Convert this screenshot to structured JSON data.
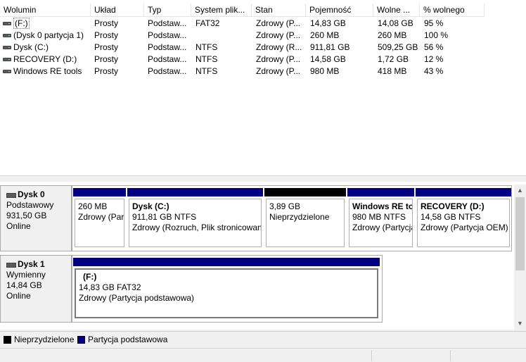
{
  "columns": {
    "volume": "Wolumin",
    "layout": "Układ",
    "type": "Typ",
    "filesystem": "System plik...",
    "status": "Stan",
    "capacity": "Pojemność",
    "free": "Wolne ...",
    "pct_free": "% wolnego"
  },
  "volumes": [
    {
      "name": "(F:)",
      "layout": "Prosty",
      "type": "Podstaw...",
      "fs": "FAT32",
      "status": "Zdrowy (P...",
      "capacity": "14,83 GB",
      "free": "14,08 GB",
      "pct": "95 %"
    },
    {
      "name": "(Dysk 0 partycja 1)",
      "layout": "Prosty",
      "type": "Podstaw...",
      "fs": "",
      "status": "Zdrowy (P...",
      "capacity": "260 MB",
      "free": "260 MB",
      "pct": "100 %"
    },
    {
      "name": "Dysk (C:)",
      "layout": "Prosty",
      "type": "Podstaw...",
      "fs": "NTFS",
      "status": "Zdrowy (R...",
      "capacity": "911,81 GB",
      "free": "509,25 GB",
      "pct": "56 %"
    },
    {
      "name": "RECOVERY (D:)",
      "layout": "Prosty",
      "type": "Podstaw...",
      "fs": "NTFS",
      "status": "Zdrowy (P...",
      "capacity": "14,58 GB",
      "free": "1,72 GB",
      "pct": "12 %"
    },
    {
      "name": "Windows RE tools",
      "layout": "Prosty",
      "type": "Podstaw...",
      "fs": "NTFS",
      "status": "Zdrowy (P...",
      "capacity": "980 MB",
      "free": "418 MB",
      "pct": "43 %"
    }
  ],
  "disks": [
    {
      "name": "Dysk 0",
      "kind": "Podstawowy",
      "size": "931,50 GB",
      "state": "Online",
      "partitions": [
        {
          "title": "",
          "line1": "260 MB",
          "line2": "Zdrowy (Partycja systemowa EFI)"
        },
        {
          "title": "Dysk  (C:)",
          "line1": "911,81 GB NTFS",
          "line2": "Zdrowy (Rozruch, Plik stronicowania)"
        },
        {
          "title": "",
          "line1": "3,89 GB",
          "line2": "Nieprzydzielone"
        },
        {
          "title": "Windows RE tools",
          "line1": "980 MB NTFS",
          "line2": "Zdrowy (Partycja OEM)"
        },
        {
          "title": "RECOVERY  (D:)",
          "line1": "14,58 GB NTFS",
          "line2": "Zdrowy (Partycja OEM)"
        }
      ]
    },
    {
      "name": "Dysk 1",
      "kind": "Wymienny",
      "size": "14,84 GB",
      "state": "Online",
      "partitions": [
        {
          "title": "(F:)",
          "line1": "14,83 GB FAT32",
          "line2": "Zdrowy (Partycja podstawowa)"
        }
      ]
    }
  ],
  "legend": {
    "unallocated": "Nieprzydzielone",
    "primary": "Partycja podstawowa",
    "unallocated_color": "#000000",
    "primary_color": "#000080"
  }
}
